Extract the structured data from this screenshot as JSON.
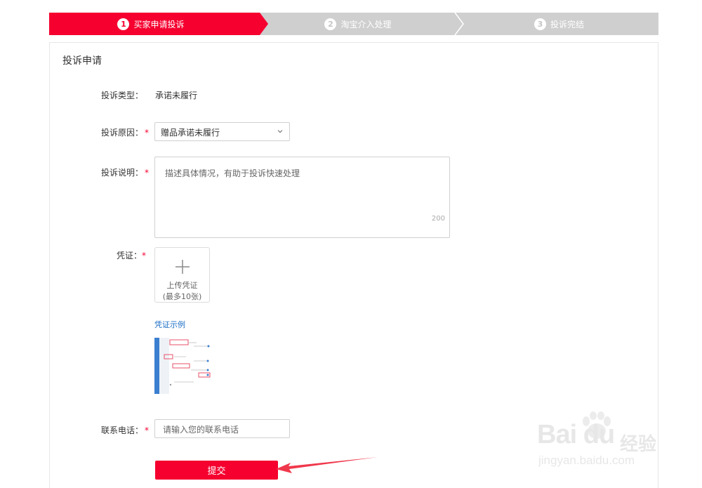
{
  "steps": [
    {
      "num": "1",
      "label": "买家申请投诉"
    },
    {
      "num": "2",
      "label": "淘宝介入处理"
    },
    {
      "num": "3",
      "label": "投诉完结"
    }
  ],
  "form": {
    "title": "投诉申请",
    "type_label": "投诉类型：",
    "type_value": "承诺未履行",
    "reason_label": "投诉原因：",
    "reason_value": "赠品承诺未履行",
    "desc_label": "投诉说明：",
    "desc_placeholder": "描述具体情况，有助于投诉快速处理",
    "desc_count": "200",
    "proof_label": "凭证：",
    "upload_line1": "上传凭证",
    "upload_line2": "(最多10张)",
    "example_link": "凭证示例",
    "phone_label": "联系电话：",
    "phone_placeholder": "请输入您的联系电话",
    "submit_label": "提交",
    "required_mark": "*"
  },
  "watermark": {
    "brand": "Bai du",
    "cn": "经验",
    "url": "jingyan.baidu.com"
  },
  "colors": {
    "accent": "#f5002f",
    "step_inactive": "#cfcfcf",
    "link": "#1e6fc6"
  }
}
